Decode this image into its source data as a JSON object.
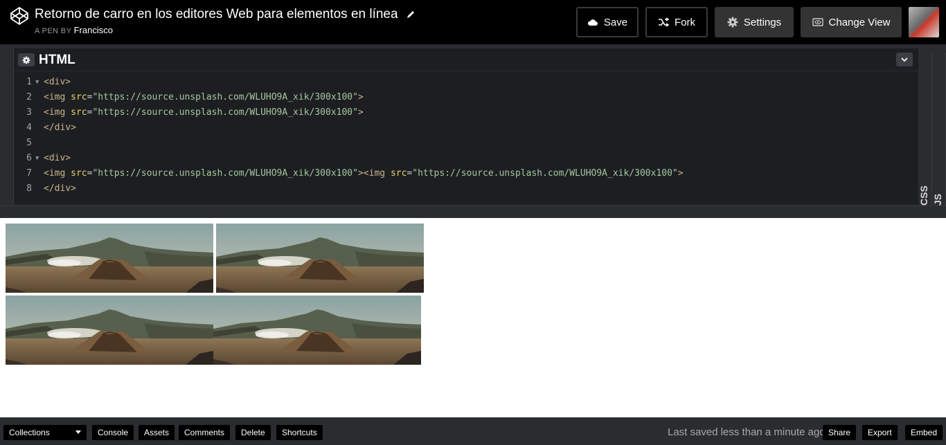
{
  "header": {
    "title": "Retorno de carro en los editores Web para elementos en línea",
    "byline_prefix": "A PEN BY",
    "author": "Francisco",
    "buttons": {
      "save": "Save",
      "fork": "Fork",
      "settings": "Settings",
      "change_view": "Change View"
    }
  },
  "editor": {
    "label": "HTML",
    "side_tabs": [
      "CSS",
      "JS"
    ],
    "lines": [
      {
        "num": "1",
        "fold": true,
        "tokens": [
          {
            "t": "tag",
            "v": "<div>"
          }
        ]
      },
      {
        "num": "2",
        "fold": false,
        "tokens": [
          {
            "t": "tag",
            "v": "<img "
          },
          {
            "t": "attr",
            "v": "src"
          },
          {
            "t": "eq",
            "v": "="
          },
          {
            "t": "str",
            "v": "\"https://source.unsplash.com/WLUHO9A_xik/300x100\""
          },
          {
            "t": "tag",
            "v": ">"
          }
        ]
      },
      {
        "num": "3",
        "fold": false,
        "tokens": [
          {
            "t": "tag",
            "v": "<img "
          },
          {
            "t": "attr",
            "v": "src"
          },
          {
            "t": "eq",
            "v": "="
          },
          {
            "t": "str",
            "v": "\"https://source.unsplash.com/WLUHO9A_xik/300x100\""
          },
          {
            "t": "tag",
            "v": ">"
          }
        ]
      },
      {
        "num": "4",
        "fold": false,
        "tokens": [
          {
            "t": "tag",
            "v": "</div>"
          }
        ]
      },
      {
        "num": "5",
        "fold": false,
        "tokens": []
      },
      {
        "num": "6",
        "fold": true,
        "tokens": [
          {
            "t": "tag",
            "v": "<div>"
          }
        ]
      },
      {
        "num": "7",
        "fold": false,
        "tokens": [
          {
            "t": "tag",
            "v": "<img "
          },
          {
            "t": "attr",
            "v": "src"
          },
          {
            "t": "eq",
            "v": "="
          },
          {
            "t": "str",
            "v": "\"https://source.unsplash.com/WLUHO9A_xik/300x100\""
          },
          {
            "t": "tag",
            "v": "><img "
          },
          {
            "t": "attr",
            "v": "src"
          },
          {
            "t": "eq",
            "v": "="
          },
          {
            "t": "str",
            "v": "\"https://source.unsplash.com/WLUHO9A_xik/300x100\""
          },
          {
            "t": "tag",
            "v": ">"
          }
        ]
      },
      {
        "num": "8",
        "fold": false,
        "tokens": [
          {
            "t": "tag",
            "v": "</div>"
          }
        ]
      }
    ]
  },
  "preview": {
    "image_description": "volcano-landscape-photo",
    "image_count": 4
  },
  "footer": {
    "collections": "Collections",
    "console": "Console",
    "assets": "Assets",
    "comments": "Comments",
    "delete": "Delete",
    "shortcuts": "Shortcuts",
    "saved_status": "Last saved less than a minute ago",
    "share": "Share",
    "export": "Export",
    "embed": "Embed"
  },
  "colors": {
    "header_bg": "#000000",
    "editor_bg": "#1d1e22",
    "chrome_bg": "#2b2c2f",
    "tag": "#c9b58c",
    "attr": "#e6d56b",
    "string": "#a6c8a0"
  }
}
